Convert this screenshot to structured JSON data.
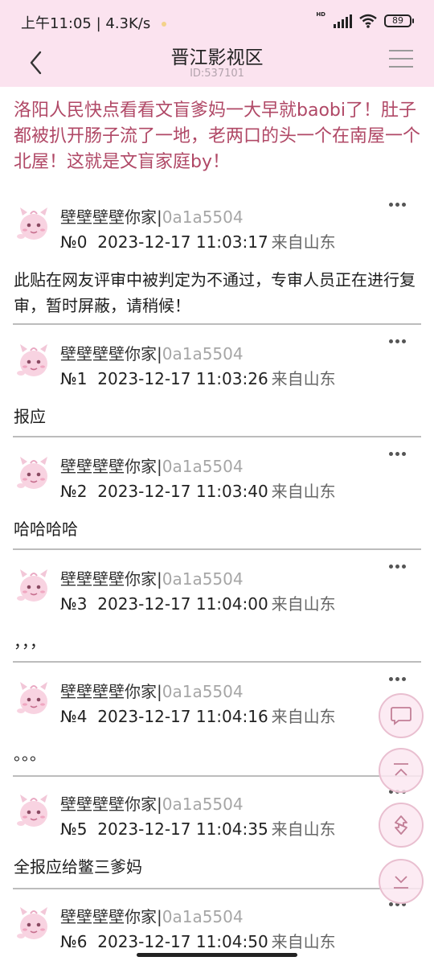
{
  "status_bar": {
    "time_speed": "上午11:05 | 4.3K/s",
    "network": "HD",
    "battery": "89"
  },
  "header": {
    "title": "晋江影视区",
    "subtitle": "ID:537101"
  },
  "post": {
    "title": "洛阳人民快点看看文盲爹妈一大早就baobi了！肚子都被扒开肠子流了一地，老两口的头一个在南屋一个北屋！这就是文盲家庭by！"
  },
  "floors": [
    {
      "user": "壁壁壁壁你家|",
      "uid": "0a1a5504",
      "floor": "№0",
      "time": "2023-12-17 11:03:17",
      "location": "来自山东",
      "content": "此贴在网友评审中被判定为不通过，专审人员正在进行复审，暂时屏蔽，请稍候！"
    },
    {
      "user": "壁壁壁壁你家|",
      "uid": "0a1a5504",
      "floor": "№1",
      "time": "2023-12-17 11:03:26",
      "location": "来自山东",
      "content": "报应"
    },
    {
      "user": "壁壁壁壁你家|",
      "uid": "0a1a5504",
      "floor": "№2",
      "time": "2023-12-17 11:03:40",
      "location": "来自山东",
      "content": "哈哈哈哈"
    },
    {
      "user": "壁壁壁壁你家|",
      "uid": "0a1a5504",
      "floor": "№3",
      "time": "2023-12-17 11:04:00",
      "location": "来自山东",
      "content": "，，，"
    },
    {
      "user": "壁壁壁壁你家|",
      "uid": "0a1a5504",
      "floor": "№4",
      "time": "2023-12-17 11:04:16",
      "location": "来自山东",
      "content": "。。。"
    },
    {
      "user": "壁壁壁壁你家|",
      "uid": "0a1a5504",
      "floor": "№5",
      "time": "2023-12-17 11:04:35",
      "location": "来自山东",
      "content": "全报应给鳖三爹妈"
    },
    {
      "user": "壁壁壁壁你家|",
      "uid": "0a1a5504",
      "floor": "№6",
      "time": "2023-12-17 11:04:50",
      "location": "来自山东",
      "content": ""
    }
  ],
  "icons": {
    "back": "chevron-left-icon",
    "menu": "hamburger-icon",
    "more": "more-dots-icon",
    "reply": "comment-icon",
    "top": "scroll-top-icon",
    "refresh": "refresh-icon",
    "bottom": "scroll-bottom-icon"
  },
  "colors": {
    "header_bg": "#fbe3ef",
    "title_text": "#b04866",
    "uid_text": "#a6a6a6",
    "fab_border": "#e9bfd0"
  }
}
